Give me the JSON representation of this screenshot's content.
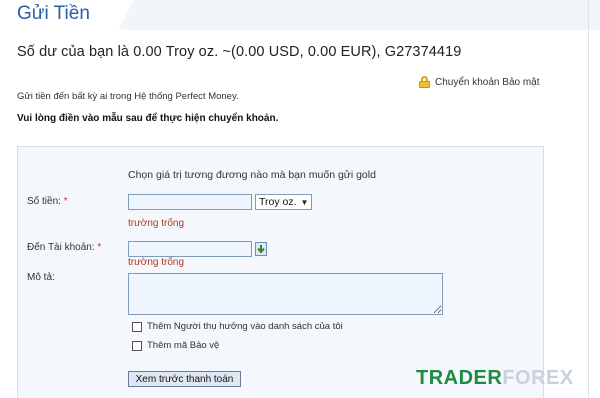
{
  "header": {
    "title": "Gửi Tiền"
  },
  "balance_line": "Số dư của bạn là 0.00 Troy oz. ~(0.00 USD, 0.00 EUR), G27374419",
  "secure_link": {
    "label": "Chuyển khoản Bảo mật",
    "icon": "lock-icon"
  },
  "intro_text": "Gửi tiền đến bất kỳ ai trong Hệ thống Perfect Money.",
  "instruction_text": "Vui lòng điền vào mẫu sau để thực hiện chuyển khoản.",
  "form": {
    "hint": "Chọn giá trị tương đương nào mà bạn muốn gửi gold",
    "amount": {
      "label": "Số tiền:",
      "required_mark": "*",
      "value": "",
      "error": "trường trống"
    },
    "unit_select": {
      "selected": "Troy oz."
    },
    "to_account": {
      "label": "Đến Tài khoản:",
      "required_mark": "*",
      "value": "",
      "error": "trường trống",
      "icon": "address-book-icon"
    },
    "description": {
      "label": "Mô tả:",
      "value": ""
    },
    "checkboxes": [
      {
        "label": "Thêm Người thụ hưởng vào danh sách của tôi",
        "checked": false
      },
      {
        "label": "Thêm mã Bảo vệ",
        "checked": false
      }
    ],
    "preview_button": "Xem trước thanh toán"
  },
  "watermark": {
    "part1": "TRADER",
    "part2": "FOREX"
  },
  "colors": {
    "accent": "#2d5ca8",
    "error": "#b03a22",
    "panel": "#f4f7fb",
    "brand_green": "#1d8c3e"
  }
}
